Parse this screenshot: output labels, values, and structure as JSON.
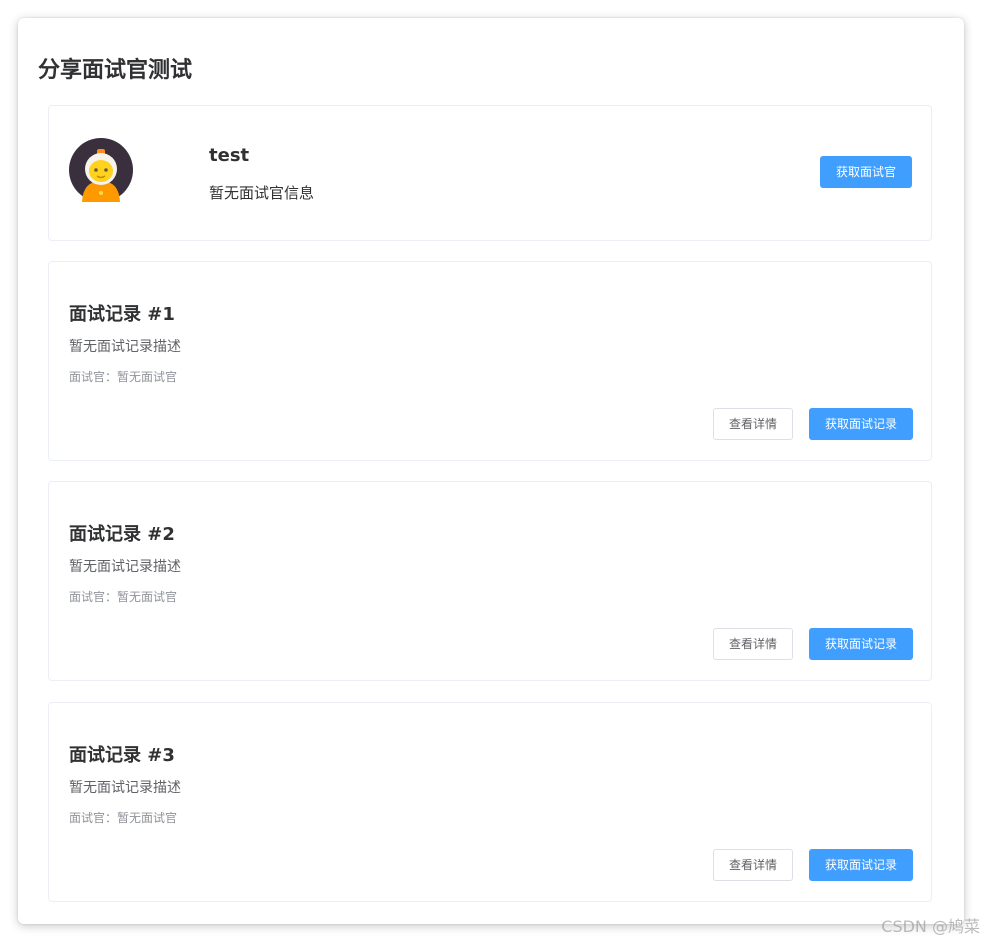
{
  "page": {
    "title": "分享面试官测试"
  },
  "profile": {
    "avatar_icon": "robot-avatar-icon",
    "name": "test",
    "info": "暂无面试官信息",
    "button_label": "获取面试官"
  },
  "records": [
    {
      "title": "面试记录 #1",
      "description": "暂无面试记录描述",
      "interviewer": "面试官：暂无面试官",
      "detail_label": "查看详情",
      "fetch_label": "获取面试记录"
    },
    {
      "title": "面试记录 #2",
      "description": "暂无面试记录描述",
      "interviewer": "面试官：暂无面试官",
      "detail_label": "查看详情",
      "fetch_label": "获取面试记录"
    },
    {
      "title": "面试记录 #3",
      "description": "暂无面试记录描述",
      "interviewer": "面试官：暂无面试官",
      "detail_label": "查看详情",
      "fetch_label": "获取面试记录"
    }
  ],
  "watermark": "CSDN @鸠菜",
  "colors": {
    "primary": "#409eff",
    "text_primary": "#303133",
    "text_regular": "#606266",
    "text_secondary": "#909399",
    "border": "#ebeef5"
  }
}
